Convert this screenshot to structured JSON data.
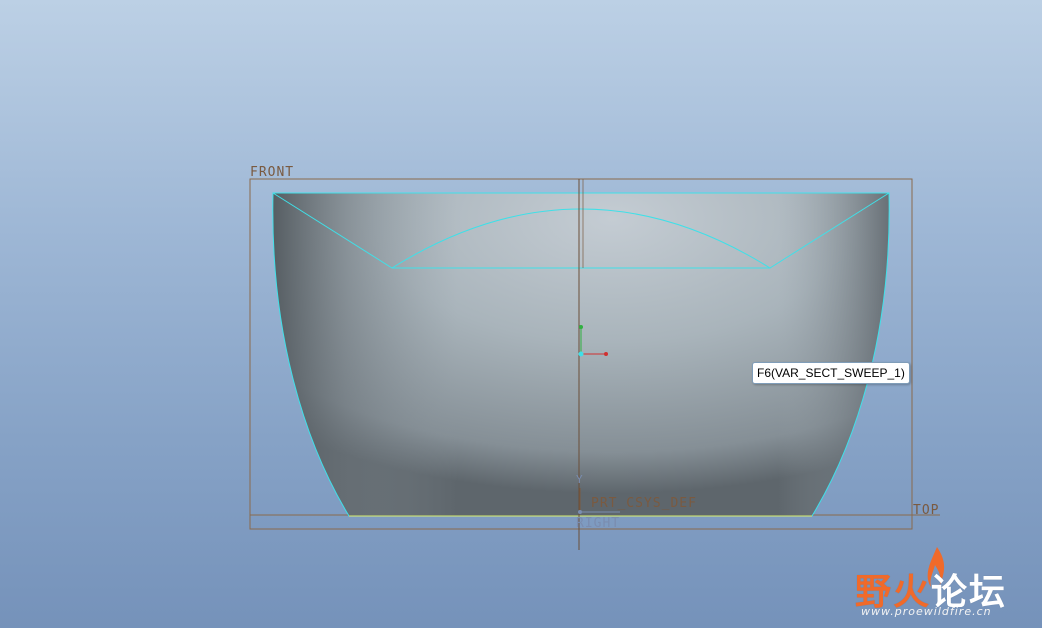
{
  "datums": {
    "front": "FRONT",
    "top": "TOP",
    "right": "RIGHT",
    "csys": "PRT_CSYS_DEF",
    "y_axis": "Y"
  },
  "tooltip": {
    "text": "F6(VAR_SECT_SWEEP_1)"
  },
  "watermark": {
    "chinese_1": "野",
    "chinese_2": "火",
    "chinese_3": "论坛",
    "url": "www.proewildfire.cn"
  },
  "colors": {
    "datum": "#8a6a4c",
    "edge_highlight": "#3fe0e8",
    "model_gray": "#a8b4bc",
    "background_top": "#bcd0e5",
    "background_bottom": "#7592ba"
  },
  "icons": {
    "x_axis": "red-axis-arrow",
    "y_axis": "green-axis-arrow",
    "csys": "coordinate-system-icon"
  }
}
